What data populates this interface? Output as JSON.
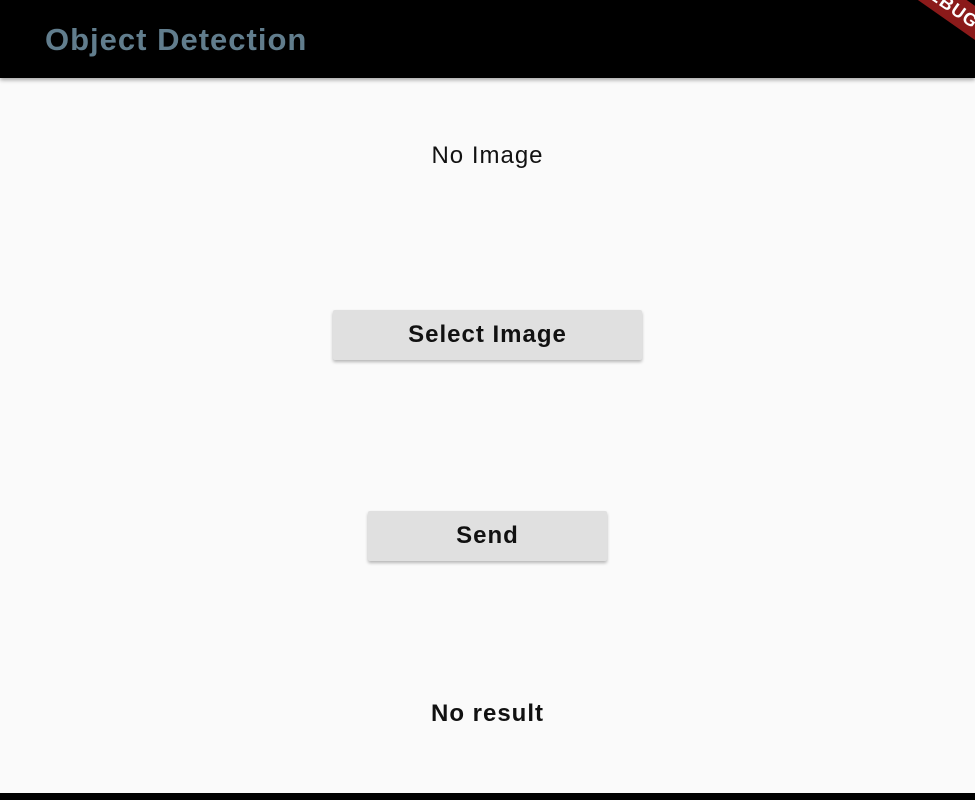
{
  "app_bar": {
    "title": "Object Detection",
    "title_color": "#617d8d",
    "background": "#000000"
  },
  "debug_banner": {
    "label": "DEBUG",
    "color": "#8b1a1a"
  },
  "main": {
    "image_status": "No Image",
    "select_image_label": "Select Image",
    "send_label": "Send",
    "result_text": "No result"
  },
  "colors": {
    "page_background": "#fafafa",
    "button_background": "#e0e0e0",
    "text": "#111111"
  }
}
